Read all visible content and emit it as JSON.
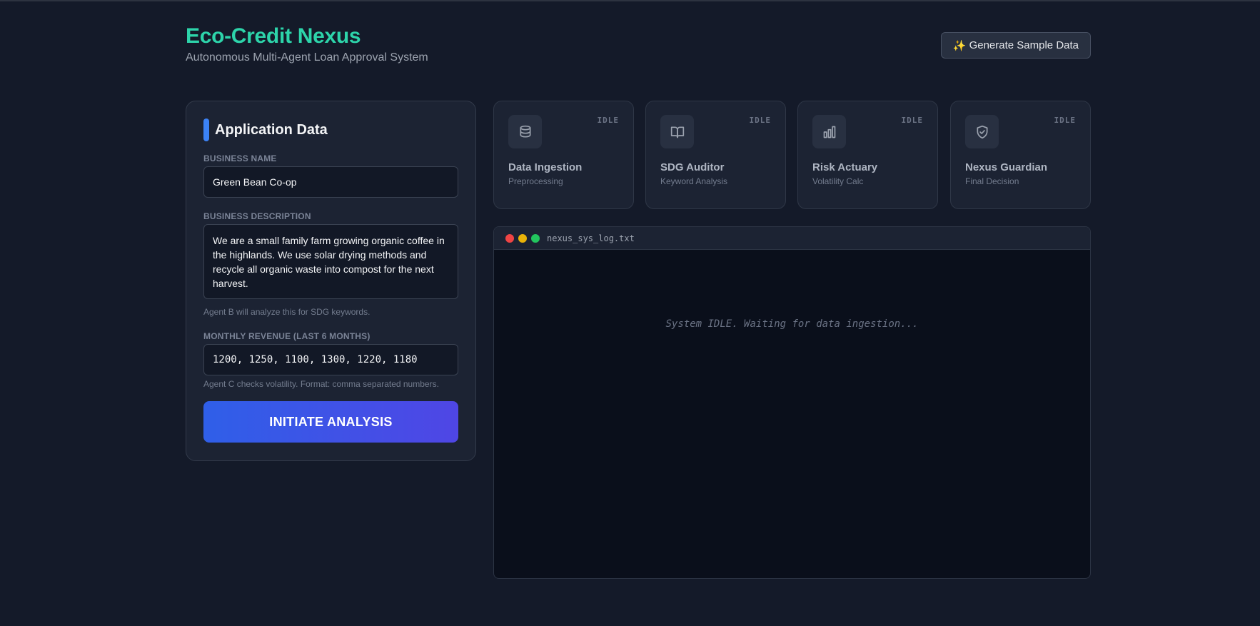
{
  "header": {
    "title": "Eco-Credit Nexus",
    "subtitle": "Autonomous Multi-Agent Loan Approval System",
    "generate_button": "Generate Sample Data",
    "generate_icon": "sparkles-icon"
  },
  "form": {
    "title": "Application Data",
    "business_name": {
      "label": "BUSINESS NAME",
      "value": "Green Bean Co-op"
    },
    "business_description": {
      "label": "BUSINESS DESCRIPTION",
      "value": "We are a small family farm growing organic coffee in the highlands. We use solar drying methods and recycle all organic waste into compost for the next harvest.",
      "hint": "Agent B will analyze this for SDG keywords."
    },
    "monthly_revenue": {
      "label": "MONTHLY REVENUE (LAST 6 MONTHS)",
      "value": "1200, 1250, 1100, 1300, 1220, 1180",
      "hint": "Agent C checks volatility. Format: comma separated numbers."
    },
    "submit_button": "INITIATE ANALYSIS"
  },
  "agents": [
    {
      "name": "Data Ingestion",
      "subtitle": "Preprocessing",
      "status": "IDLE",
      "icon": "database-icon"
    },
    {
      "name": "SDG Auditor",
      "subtitle": "Keyword Analysis",
      "status": "IDLE",
      "icon": "book-icon"
    },
    {
      "name": "Risk Actuary",
      "subtitle": "Volatility Calc",
      "status": "IDLE",
      "icon": "bar-chart-icon"
    },
    {
      "name": "Nexus Guardian",
      "subtitle": "Final Decision",
      "status": "IDLE",
      "icon": "shield-check-icon"
    }
  ],
  "terminal": {
    "filename": "nexus_sys_log.txt",
    "message": "System IDLE. Waiting for data ingestion..."
  },
  "colors": {
    "accent_teal": "#2dd4aa",
    "accent_blue": "#3b82f6",
    "button_gradient_start": "#2f5fe8",
    "button_gradient_end": "#4f46e5",
    "dot_red": "#ef4444",
    "dot_yellow": "#eab308",
    "dot_green": "#22c55e"
  }
}
